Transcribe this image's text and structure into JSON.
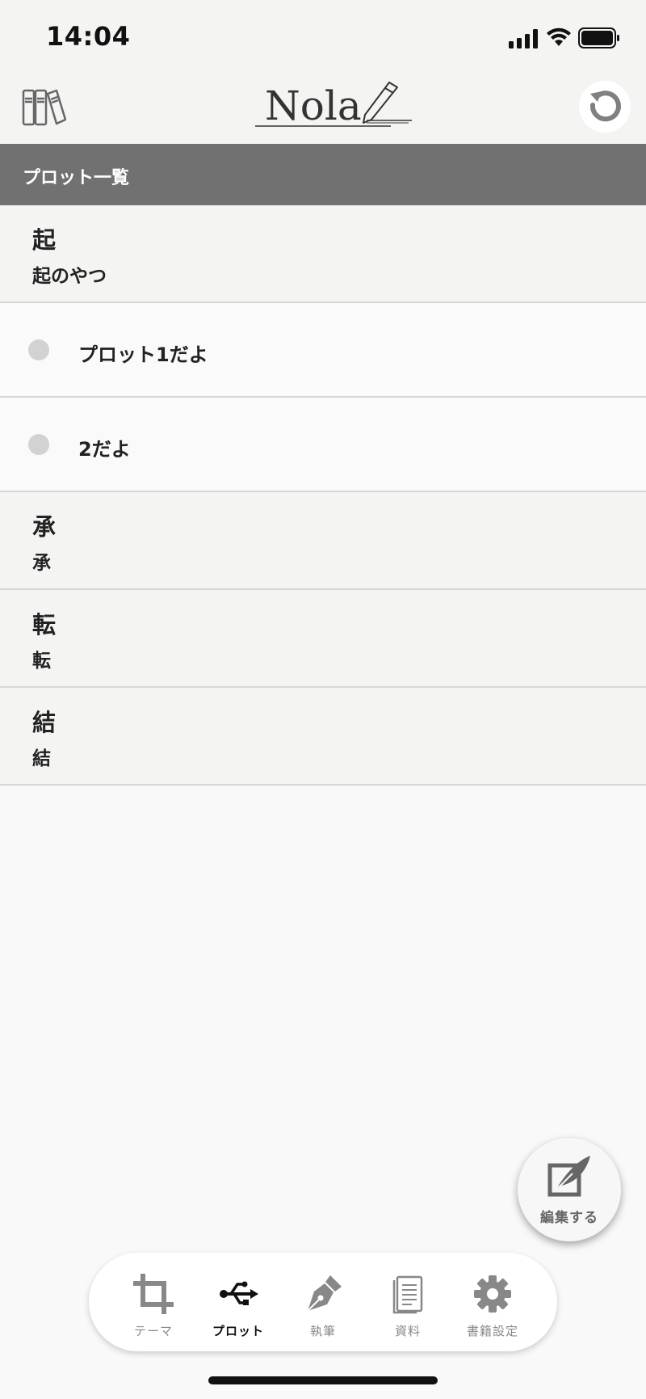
{
  "status_bar": {
    "time": "14:04"
  },
  "header": {
    "logo_text": "Nola"
  },
  "section": {
    "title": "プロット一覧"
  },
  "acts": [
    {
      "title": "起",
      "subtitle": "起のやつ",
      "plots": [
        "プロット1だよ",
        "2だよ"
      ]
    },
    {
      "title": "承",
      "subtitle": "承",
      "plots": []
    },
    {
      "title": "転",
      "subtitle": "転",
      "plots": []
    },
    {
      "title": "結",
      "subtitle": "結",
      "plots": []
    }
  ],
  "fab": {
    "label": "編集する"
  },
  "tabs": [
    {
      "label": "テーマ",
      "icon": "crop-icon",
      "active": false
    },
    {
      "label": "プロット",
      "icon": "usb-icon",
      "active": true
    },
    {
      "label": "執筆",
      "icon": "pen-nib-icon",
      "active": false
    },
    {
      "label": "資料",
      "icon": "document-icon",
      "active": false
    },
    {
      "label": "書籍設定",
      "icon": "gear-icon",
      "active": false
    }
  ],
  "colors": {
    "header_bg": "#717171",
    "act_bg": "#f4f4f3",
    "plot_bg": "#fafafa",
    "timeline": "#d2d2d2",
    "tab_active": "#111111",
    "tab_inactive": "#888888"
  }
}
